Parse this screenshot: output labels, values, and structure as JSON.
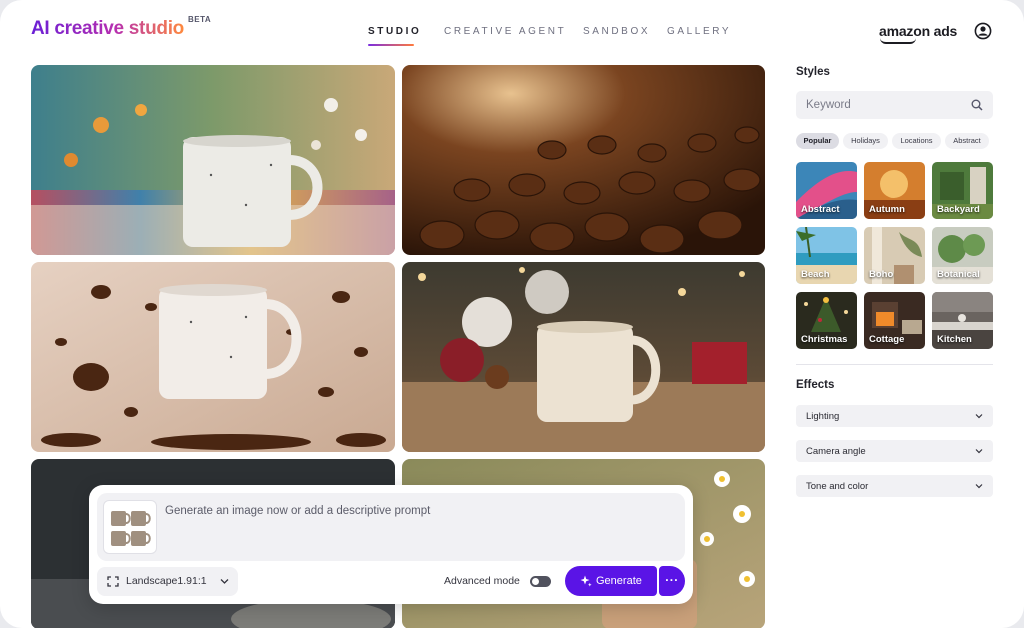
{
  "header": {
    "brand": "AI creative studio",
    "beta": "BETA",
    "nav": [
      {
        "label": "STUDIO",
        "active": true
      },
      {
        "label": "CREATIVE AGENT",
        "active": false
      },
      {
        "label": "SANDBOX",
        "active": false
      },
      {
        "label": "GALLERY",
        "active": false
      }
    ],
    "partner_logo": "amazon ads",
    "user_icon": "user-circle-icon"
  },
  "gallery": {
    "images": [
      {
        "subject": "White speckled mug on striped blanket with autumn flowers"
      },
      {
        "subject": "Roasted coffee beans close-up"
      },
      {
        "subject": "Floating mug with flying coffee beans"
      },
      {
        "subject": "Mug on wooden table with Christmas ornaments"
      },
      {
        "subject": "Mug on dark background"
      },
      {
        "subject": "Mug with daisies"
      }
    ]
  },
  "prompt": {
    "placeholder": "Generate an image now or add a descriptive prompt",
    "aspect_label": "Landscape1.91:1",
    "advanced_label": "Advanced mode",
    "advanced_on": false,
    "generate_label": "Generate",
    "more_label": "···"
  },
  "styles": {
    "title": "Styles",
    "search_placeholder": "Keyword",
    "chips": [
      {
        "label": "Popular",
        "active": true
      },
      {
        "label": "Holidays",
        "active": false
      },
      {
        "label": "Locations",
        "active": false
      },
      {
        "label": "Abstract",
        "active": false
      }
    ],
    "cards": [
      "Abstract",
      "Autumn",
      "Backyard",
      "Beach",
      "Boho",
      "Botanical",
      "Christmas",
      "Cottage",
      "Kitchen"
    ]
  },
  "effects": {
    "title": "Effects",
    "items": [
      "Lighting",
      "Camera angle",
      "Tone and color"
    ]
  },
  "colors": {
    "accent": "#5a14e6",
    "brand_gradient_start": "#6a1fd6",
    "brand_gradient_end": "#ff8a3d"
  }
}
